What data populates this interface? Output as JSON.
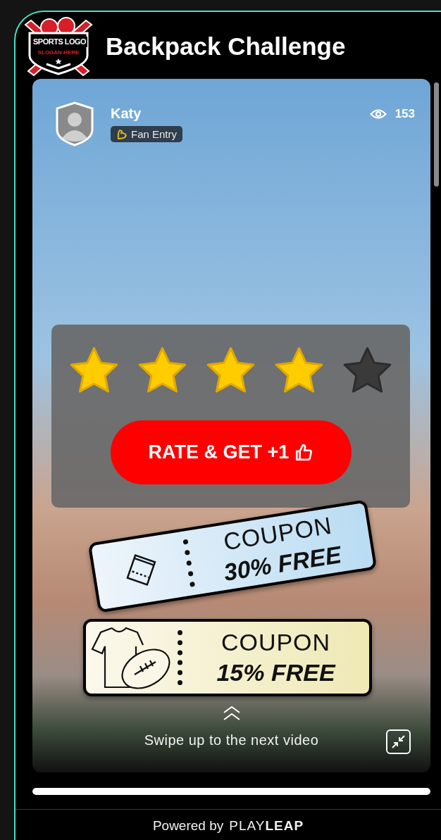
{
  "header": {
    "logo": {
      "line_1": "SPORTS LOGO",
      "line_2": "SLOGAN HERE"
    },
    "title": "Backpack Challenge"
  },
  "post": {
    "author": "Katy",
    "badge": "Fan Entry",
    "views": "153"
  },
  "rating": {
    "stars": 4,
    "button": "RATE & GET +1"
  },
  "coupons": [
    {
      "kind": "ticket",
      "line_1": "COUPON",
      "line_2": "30% FREE"
    },
    {
      "kind": "merch",
      "line_1": "COUPON",
      "line_2": "15% FREE"
    }
  ],
  "swipe_hint": "Swipe up to the next video",
  "progress": {
    "level": 1
  },
  "footer": {
    "text": "Powered by",
    "brand_light": "PLAY",
    "brand_bold": "LEAP"
  }
}
